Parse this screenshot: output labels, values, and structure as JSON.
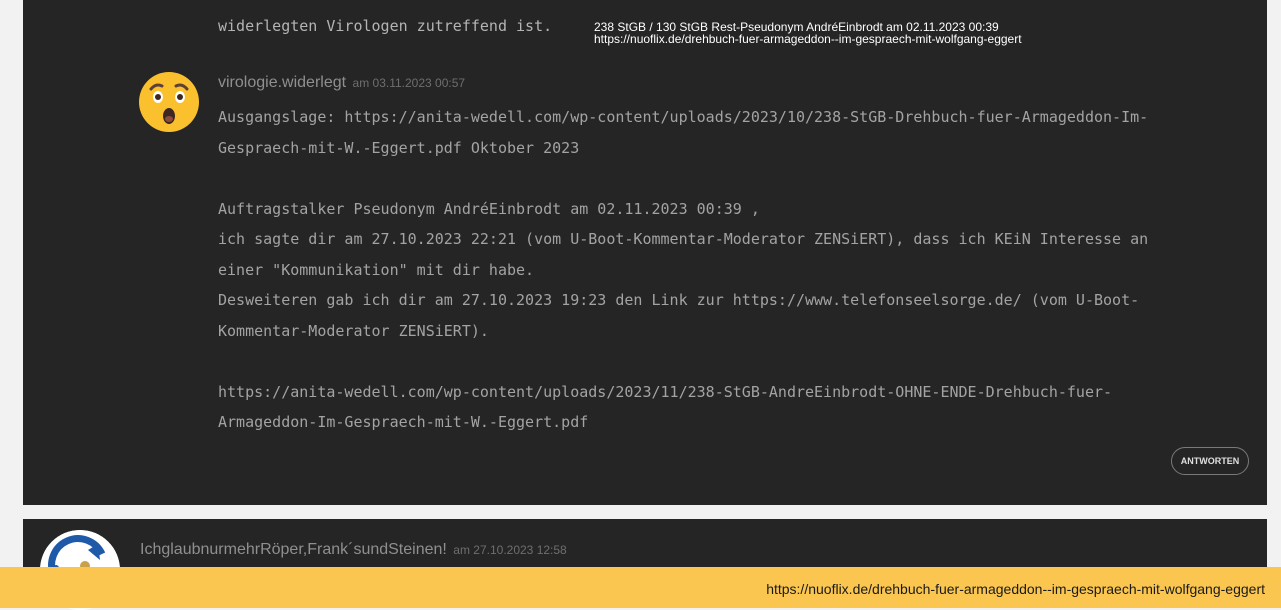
{
  "prev_comment": {
    "text_tail": "widerlegten Virologen zutreffend ist.",
    "note_line1": "238 StGB / 130 StGB Rest-Pseudonym AndréEinbrodt  am 02.11.2023 00:39",
    "note_line2": "https://nuoflix.de/drehbuch-fuer-armageddon--im-gespraech-mit-wolfgang-eggert"
  },
  "comment": {
    "avatar_icon": "surprised-face-emoji-icon",
    "author": "virologie.widerlegt",
    "date": "am 03.11.2023 00:57",
    "lines": [
      "Ausgangslage: https://anita-wedell.com/wp-content/uploads/2023/10/238-StGB-Drehbuch-fuer-Armageddon-Im-",
      "Gespraech-mit-W.-Eggert.pdf Oktober 2023",
      "",
      "Auftragstalker Pseudonym AndréEinbrodt  am 02.11.2023 00:39 ,",
      "ich sagte dir am 27.10.2023 22:21 (vom U-Boot-Kommentar-Moderator ZENSiERT), dass ich KEiN Interesse an",
      "einer \"Kommunikation\" mit dir habe.",
      "Desweiteren gab ich dir am 27.10.2023 19:23 den Link zur https://www.telefonseelsorge.de/ (vom U-Boot-",
      "Kommentar-Moderator ZENSiERT).",
      "",
      "https://anita-wedell.com/wp-content/uploads/2023/11/238-StGB-AndreEinbrodt-OHNE-ENDE-Drehbuch-fuer-",
      "Armageddon-Im-Gespraech-mit-W.-Eggert.pdf"
    ],
    "reply_label": "ANTWORTEN"
  },
  "next_comment": {
    "author": "IchglaubnurmehrRöper,Frank´sundSteinen!",
    "date": "am 27.10.2023 12:58"
  },
  "status_bar": {
    "url": "https://nuoflix.de/drehbuch-fuer-armageddon--im-gespraech-mit-wolfgang-eggert"
  },
  "colors": {
    "panel_bg": "#252525",
    "page_bg": "#f2f2f2",
    "status_bar_bg": "#fbc64f",
    "emoji_yellow": "#fbc02d"
  }
}
